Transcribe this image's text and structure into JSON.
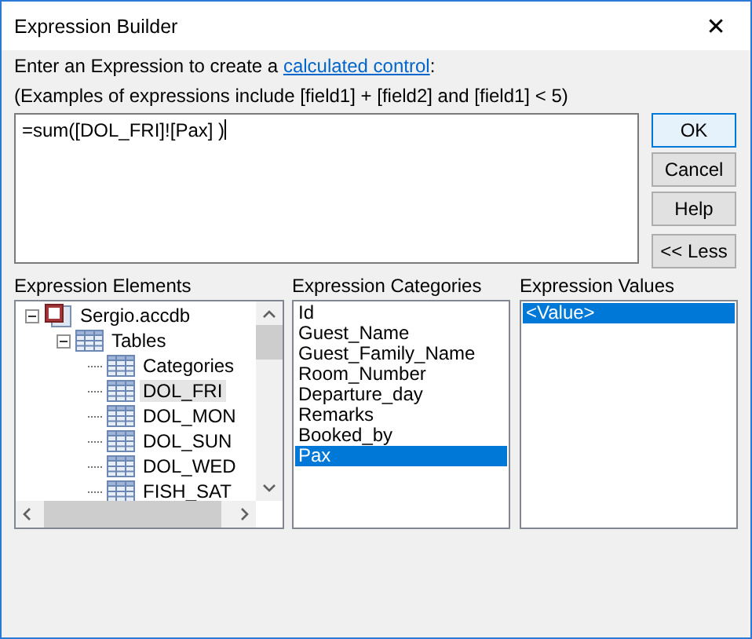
{
  "window": {
    "title": "Expression Builder",
    "close": "✕"
  },
  "instruction": {
    "text": "Enter an Expression to create a ",
    "link": "calculated control",
    "suffix": ":"
  },
  "examples": "(Examples of expressions include [field1] + [field2] and [field1] < 5)",
  "expression": {
    "value": "=sum([DOL_FRI]![Pax] )"
  },
  "buttons": [
    {
      "label": "OK",
      "default": true
    },
    {
      "label": "Cancel",
      "default": false
    },
    {
      "label": "Help",
      "default": false
    },
    {
      "label": "<< Less",
      "default": false
    }
  ],
  "elements": {
    "label": "Expression Elements",
    "tree": [
      {
        "label": "Sergio.accdb",
        "kind": "database",
        "expanded": true,
        "selected": false,
        "children": [
          {
            "label": "Tables",
            "kind": "folder",
            "expanded": true,
            "selected": false,
            "children": [
              {
                "label": "Categories",
                "kind": "table",
                "selected": false
              },
              {
                "label": "DOL_FRI",
                "kind": "table",
                "selected": true
              },
              {
                "label": "DOL_MON",
                "kind": "table",
                "selected": false
              },
              {
                "label": "DOL_SUN",
                "kind": "table",
                "selected": false
              },
              {
                "label": "DOL_WED",
                "kind": "table",
                "selected": false
              },
              {
                "label": "FISH_SAT",
                "kind": "table",
                "selected": false
              }
            ]
          }
        ]
      }
    ]
  },
  "categories": {
    "label": "Expression Categories",
    "items": [
      {
        "label": "Id",
        "selected": false
      },
      {
        "label": "Guest_Name",
        "selected": false
      },
      {
        "label": "Guest_Family_Name",
        "selected": false
      },
      {
        "label": "Room_Number",
        "selected": false
      },
      {
        "label": "Departure_day",
        "selected": false
      },
      {
        "label": "Remarks",
        "selected": false
      },
      {
        "label": "Booked_by",
        "selected": false
      },
      {
        "label": "Pax",
        "selected": true
      }
    ]
  },
  "values": {
    "label": "Expression Values",
    "items": [
      {
        "label": "<Value>",
        "selected": true
      }
    ]
  }
}
